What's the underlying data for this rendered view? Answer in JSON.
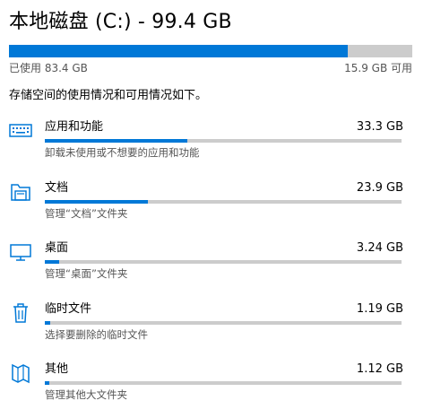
{
  "drive": {
    "title": "本地磁盘 (C:) - 99.4 GB",
    "used_label": "已使用 83.4 GB",
    "free_label": "15.9 GB 可用",
    "used_fraction": 0.839
  },
  "intro_text": "存储空间的使用情况和可用情况如下。",
  "accent_color": "#0078d7",
  "track_color": "#cccccc",
  "categories": [
    {
      "icon": "keyboard-icon",
      "name": "应用和功能",
      "size": "33.3 GB",
      "desc": "卸载未使用或不想要的应用和功能",
      "fraction": 0.4
    },
    {
      "icon": "documents-icon",
      "name": "文档",
      "size": "23.9 GB",
      "desc": "管理“文档”文件夹",
      "fraction": 0.29
    },
    {
      "icon": "monitor-icon",
      "name": "桌面",
      "size": "3.24 GB",
      "desc": "管理“桌面”文件夹",
      "fraction": 0.04
    },
    {
      "icon": "trash-icon",
      "name": "临时文件",
      "size": "1.19 GB",
      "desc": "选择要删除的临时文件",
      "fraction": 0.014
    },
    {
      "icon": "map-icon",
      "name": "其他",
      "size": "1.12 GB",
      "desc": "管理其他大文件夹",
      "fraction": 0.013
    }
  ]
}
